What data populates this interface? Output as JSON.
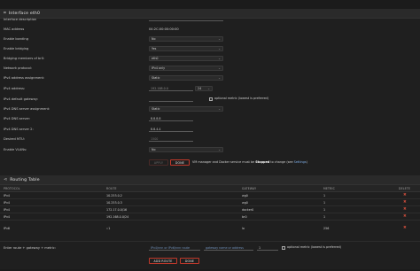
{
  "interface_panel": {
    "title": "Interface eth0",
    "fields": [
      {
        "label": "Interface description",
        "value": ""
      },
      {
        "label": "MAC address",
        "value": "04:2C:00:00:00:00"
      },
      {
        "label": "Enable bonding",
        "value": "No"
      },
      {
        "label": "Enable bridging",
        "value": "Yes"
      },
      {
        "label": "Bridging members of br0:",
        "value": "eth0"
      },
      {
        "label": "Network protocol:",
        "value": "IPv4 only"
      },
      {
        "label": "IPv4 address assignment:",
        "value": "Static"
      },
      {
        "label": "IPv4 address:",
        "value": "192.168.0.0",
        "mask": "24"
      },
      {
        "label": "IPv4 default gateway:",
        "value": "",
        "gateway_metric_note": "optional metric (lowest is preferred)"
      },
      {
        "label": "IPv4 DNS server assignment:",
        "value": "Static"
      },
      {
        "label": "IPv4 DNS server:",
        "value": "8.8.8.8"
      },
      {
        "label": "IPv4 DNS server 2:",
        "value": "8.8.4.4"
      },
      {
        "label": "Desired MTU:",
        "value": "1500"
      },
      {
        "label": "Enable VLANs:",
        "value": "No"
      }
    ],
    "apply_label": "APPLY",
    "done_label": "DONE",
    "note_prefix": "VM manager and Docker service must be ",
    "note_bold": "Stopped",
    "note_suffix": " to change (see ",
    "note_link": "Settings",
    "note_end": ")"
  },
  "routing_panel": {
    "title": "Routing Table",
    "columns": {
      "protocol": "PROTOCOL",
      "route": "ROUTE",
      "gateway": "GATEWAY",
      "metric": "METRIC",
      "delete": "DELETE"
    },
    "rows": [
      {
        "protocol": "IPv4",
        "route": "10.253.0.2",
        "gateway": "wg0",
        "metric": "1"
      },
      {
        "protocol": "IPv4",
        "route": "10.253.0.3",
        "gateway": "wg0",
        "metric": "1"
      },
      {
        "protocol": "IPv4",
        "route": "172.17.0.0/16",
        "gateway": "docker0",
        "metric": "1"
      },
      {
        "protocol": "IPv4",
        "route": "192.168.0.0/24",
        "gateway": "br0",
        "metric": "1"
      },
      {
        "protocol": "IPv6",
        "route": "::1",
        "gateway": "lo",
        "metric": "256"
      }
    ],
    "add_row_label": "Enter route + gateway + metric:",
    "route_placeholder": "IPv4/nnn or IPv6/nnn route",
    "gateway_placeholder": "gateway name or address",
    "metric_value": "1",
    "metric_note": "optional metric (lowest is preferred)",
    "add_route_label": "ADD ROUTE",
    "done_label": "DONE"
  },
  "colors": {
    "background": "#1b1b1b",
    "accent": "#c0392b",
    "link": "#7faee8",
    "delete": "#c24a3a"
  }
}
